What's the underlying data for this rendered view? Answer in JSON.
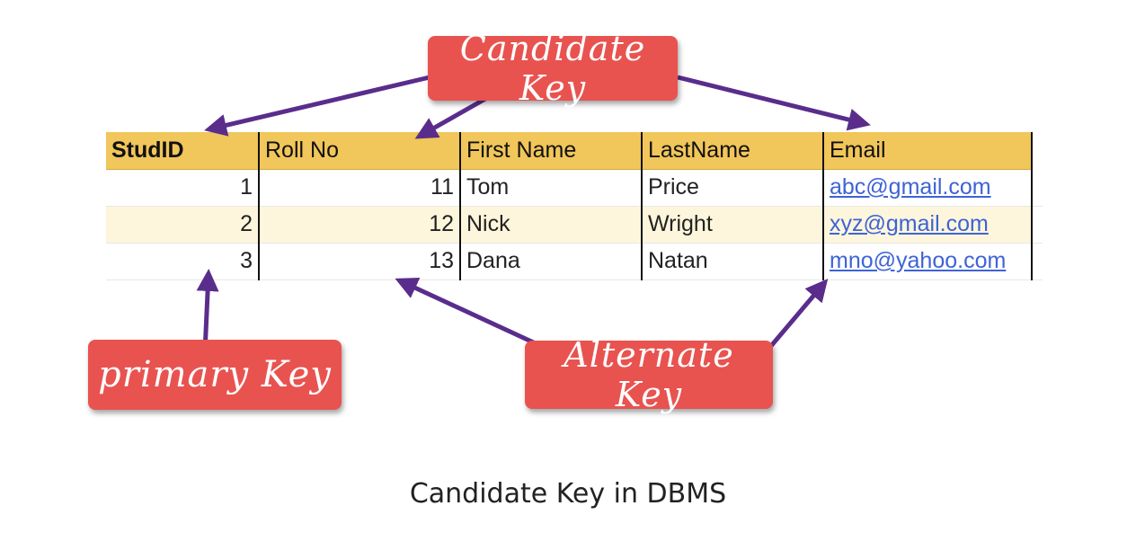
{
  "table": {
    "headers": [
      "StudID",
      "Roll No",
      "First Name",
      "LastName",
      "Email"
    ],
    "rows": [
      {
        "studid": "1",
        "rollno": "11",
        "first": "Tom",
        "last": "Price",
        "email": "abc@gmail.com"
      },
      {
        "studid": "2",
        "rollno": "12",
        "first": "Nick",
        "last": "Wright",
        "email": "xyz@gmail.com"
      },
      {
        "studid": "3",
        "rollno": "13",
        "first": "Dana",
        "last": "Natan",
        "email": "mno@yahoo.com"
      }
    ]
  },
  "callouts": {
    "candidate": "Candidate Key",
    "primary": "primary Key",
    "alternate": "Alternate Key"
  },
  "caption": "Candidate Key in DBMS",
  "colors": {
    "header_bg": "#f1c65a",
    "callout_bg": "#e85350",
    "arrow": "#5a2d8c",
    "link": "#3e63d6",
    "alt_row": "#fdf6dc"
  }
}
